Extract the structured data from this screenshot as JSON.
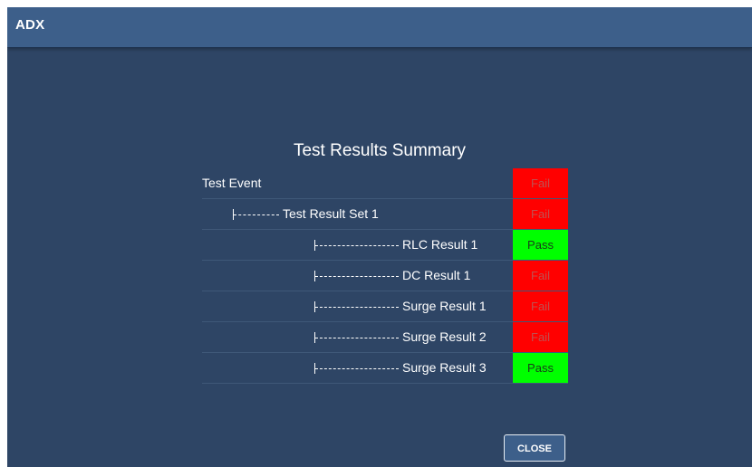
{
  "app": {
    "title": "ADX"
  },
  "summary": {
    "title": "Test Results Summary",
    "rows": [
      {
        "label": "Test Event",
        "status": "Fail",
        "state": "fail",
        "level": 0
      },
      {
        "label": "Test Result Set 1",
        "status": "Fail",
        "state": "fail",
        "level": 1
      },
      {
        "label": "RLC Result 1",
        "status": "Pass",
        "state": "pass",
        "level": 2
      },
      {
        "label": "DC Result 1",
        "status": "Fail",
        "state": "fail",
        "level": 2
      },
      {
        "label": "Surge Result 1",
        "status": "Fail",
        "state": "fail",
        "level": 2
      },
      {
        "label": "Surge Result 2",
        "status": "Fail",
        "state": "fail",
        "level": 2
      },
      {
        "label": "Surge Result 3",
        "status": "Pass",
        "state": "pass",
        "level": 2
      }
    ]
  },
  "colors": {
    "window_bg": "#2e4565",
    "titlebar_bg": "#3d5f8a",
    "fail": "#ff0000",
    "pass": "#00ff00"
  },
  "buttons": {
    "close_label": "CLOSE"
  }
}
